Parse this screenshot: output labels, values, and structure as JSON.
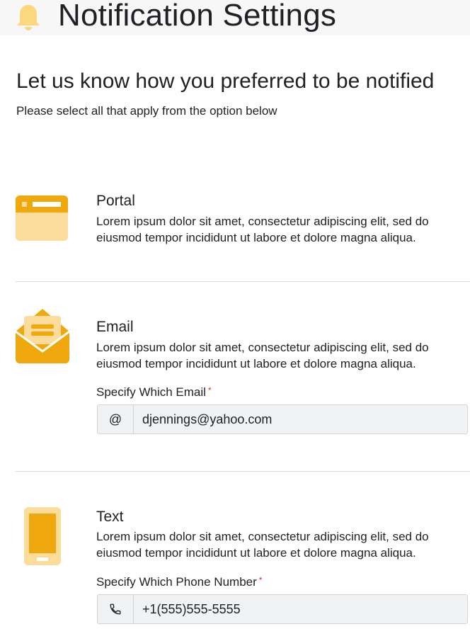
{
  "page": {
    "title": "Notification Settings",
    "subtitle": "Let us know how you preferred to be notified",
    "instructions": "Please select all that apply from the option below"
  },
  "colors": {
    "accent": "#efa80d",
    "accent_light": "#fbdc9a",
    "divider": "#d9dadc",
    "required": "#d93025"
  },
  "options": [
    {
      "icon": "browser-window-icon",
      "title": "Portal",
      "description": "Lorem ipsum dolor sit amet, consectetur adipiscing elit, sed do eiusmod tempor incididunt ut labore et dolore magna aliqua."
    },
    {
      "icon": "open-envelope-icon",
      "title": "Email",
      "description": "Lorem ipsum dolor sit amet, consectetur adipiscing elit, sed do eiusmod tempor incididunt ut labore et dolore magna aliqua.",
      "field": {
        "label": "Specify Which Email",
        "required_mark": "*",
        "addon": "@",
        "value": "djennings@yahoo.com"
      }
    },
    {
      "icon": "smartphone-icon",
      "title": "Text",
      "description": "Lorem ipsum dolor sit amet, consectetur adipiscing elit, sed do eiusmod tempor incididunt ut labore et dolore magna aliqua.",
      "field": {
        "label": "Specify Which Phone Number",
        "required_mark": "*",
        "addon_icon": "phone-icon",
        "value": "+1(555)555-5555"
      }
    }
  ]
}
